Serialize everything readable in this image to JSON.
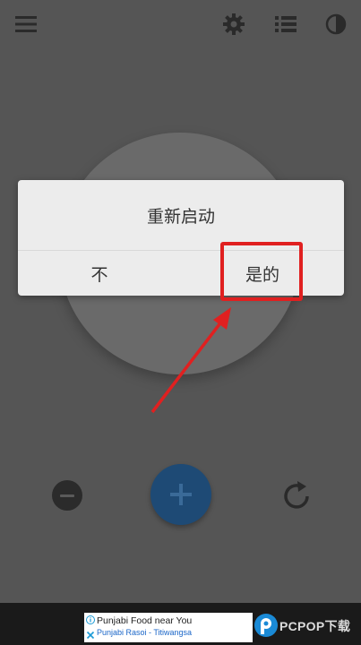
{
  "toolbar": {
    "icons": [
      "menu-icon",
      "gear-icon",
      "list-icon",
      "contrast-icon"
    ]
  },
  "dialog": {
    "title": "重新启动",
    "no_label": "不",
    "yes_label": "是的"
  },
  "controls": {
    "icons": [
      "minus-icon",
      "plus-icon",
      "reset-icon"
    ]
  },
  "ad": {
    "title": "Punjabi Food near You",
    "subtitle": "Punjabi Rasoi - Titiwangsa"
  },
  "watermark": {
    "text": "PCPOP下载"
  },
  "colors": {
    "background": "#555555",
    "dialog": "#ececec",
    "accent_button": "#1e4a75",
    "highlight": "#e02020"
  }
}
